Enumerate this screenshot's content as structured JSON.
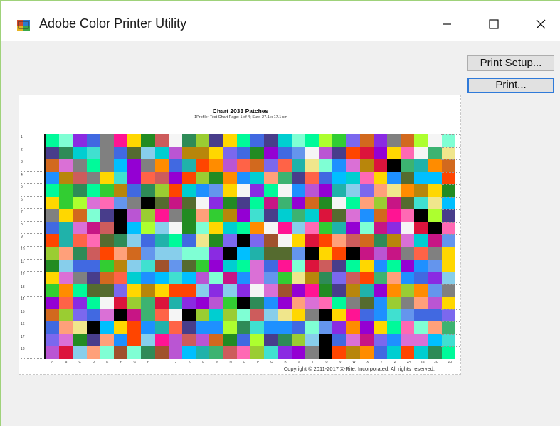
{
  "window": {
    "title": "Adobe Color Printer Utility",
    "icon": "printer-app-icon",
    "controls": [
      "minimize-icon",
      "maximize-icon",
      "close-icon"
    ]
  },
  "buttons": {
    "print_setup": "Print Setup...",
    "print": "Print..."
  },
  "preview": {
    "title": "Chart 2033 Patches",
    "subtitle": "i1Profiler Test Chart Page: 1 of 4; Size: 27.1 x 17.1 cm",
    "rows": 18,
    "columns": 30,
    "row_labels": [
      "1",
      "2",
      "3",
      "4",
      "5",
      "6",
      "7",
      "8",
      "9",
      "10",
      "11",
      "12",
      "13",
      "14",
      "15",
      "16",
      "17",
      "18"
    ],
    "column_labels": [
      "A",
      "B",
      "C",
      "D",
      "E",
      "F",
      "G",
      "H",
      "I",
      "J",
      "K",
      "L",
      "M",
      "N",
      "O",
      "P",
      "Q",
      "R",
      "S",
      "T",
      "U",
      "V",
      "W",
      "X",
      "Y",
      "Z",
      "2A",
      "2B",
      "2C",
      "2D"
    ],
    "copyright": "Copyright © 2011-2017 X-Rite, Incorporated. All rights reserved.",
    "palette": [
      "#1e90ff",
      "#ff69b4",
      "#32cd32",
      "#ffd700",
      "#8a2be2",
      "#ff4500",
      "#00ced1",
      "#adff2f",
      "#dc143c",
      "#4169e1",
      "#ff8c00",
      "#2e8b57",
      "#da70d6",
      "#87ceeb",
      "#b8860b",
      "#000000",
      "#f5f5f5",
      "#808080",
      "#9400d3",
      "#00fa9a",
      "#ff1493",
      "#556b2f",
      "#7fffd4",
      "#cd5c5c",
      "#6495ed",
      "#f0e68c",
      "#483d8b",
      "#3cb371",
      "#ffa07a",
      "#20b2aa",
      "#ba55d3",
      "#9acd32",
      "#a0522d",
      "#00bfff",
      "#ff6347",
      "#228b22",
      "#c71585",
      "#7b68ee",
      "#d2691e",
      "#40e0d0"
    ]
  }
}
